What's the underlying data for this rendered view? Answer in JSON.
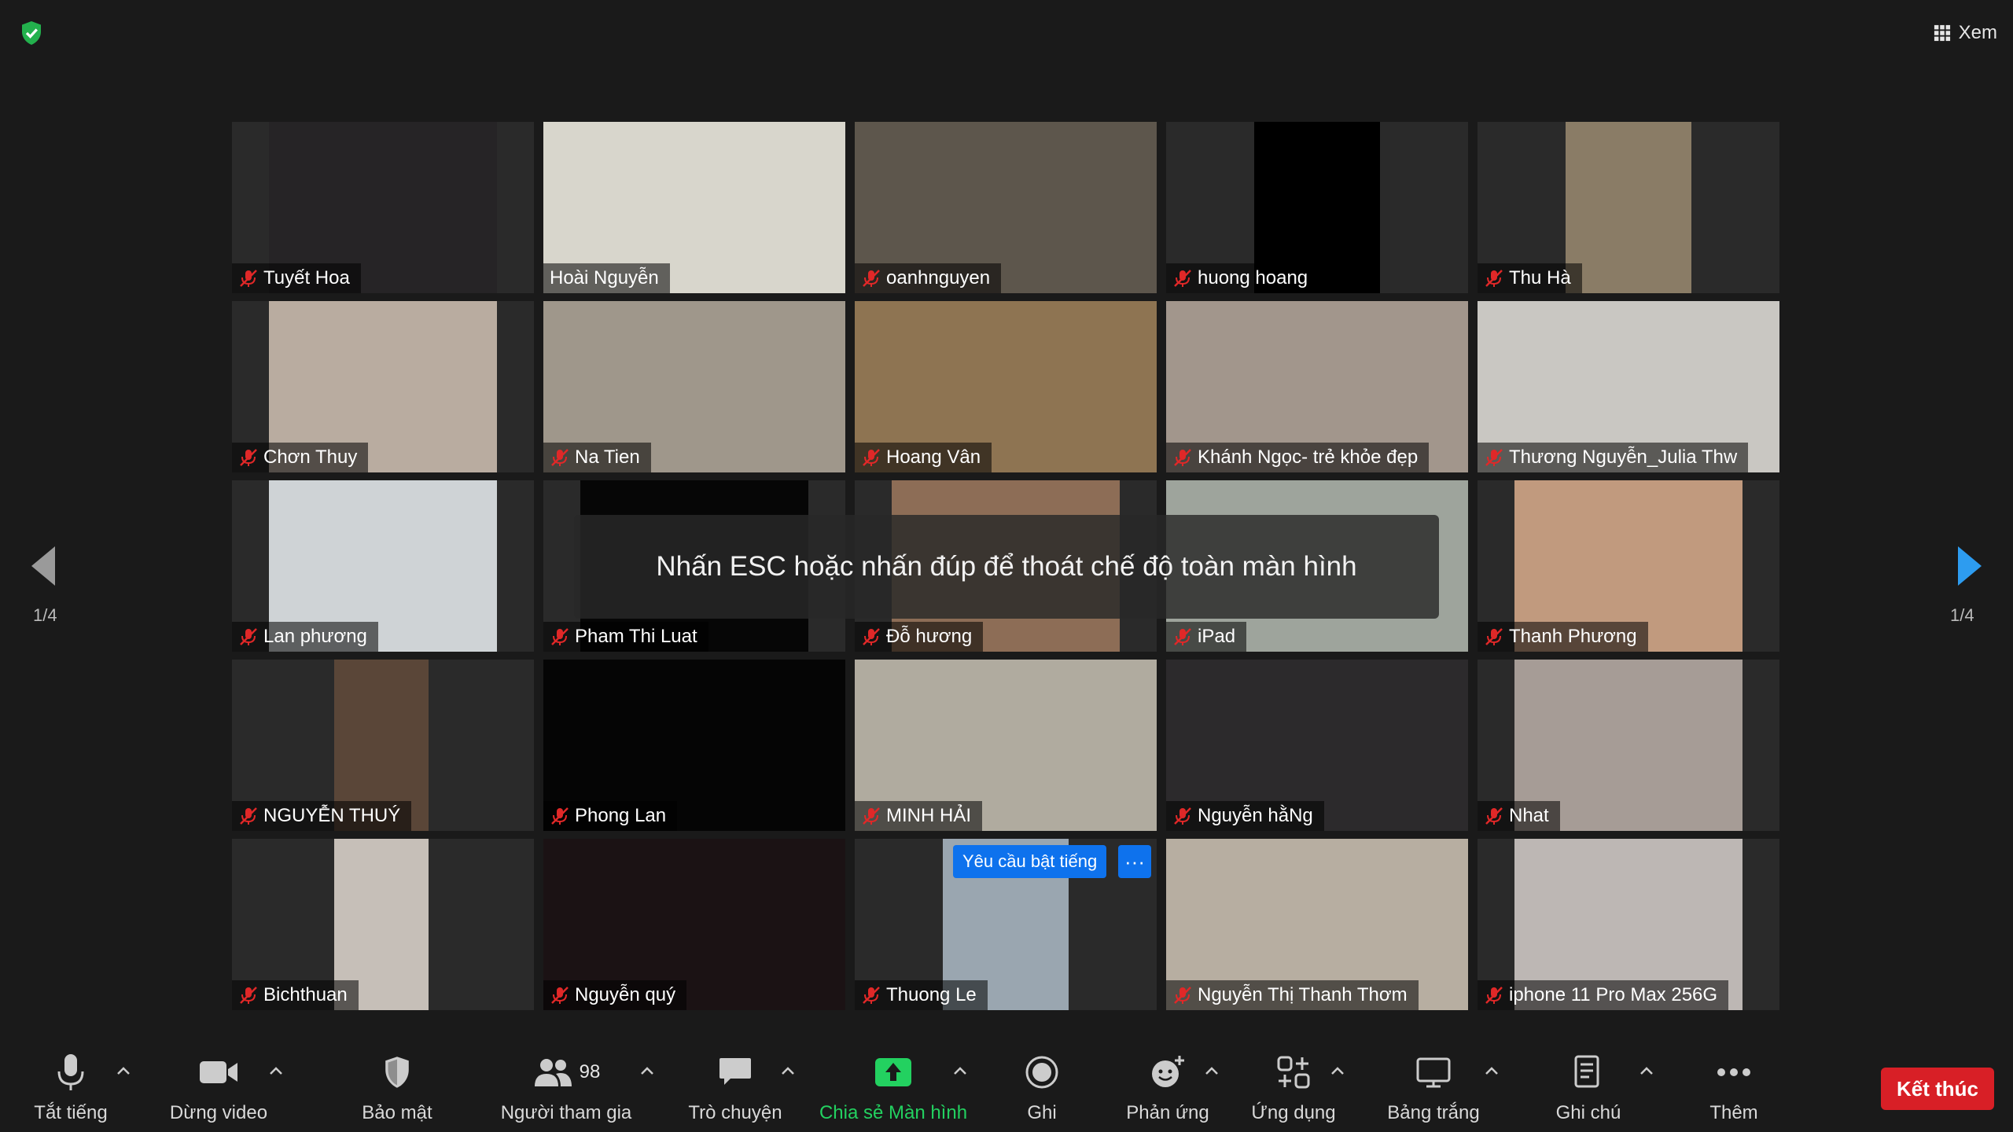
{
  "top": {
    "view_label": "Xem"
  },
  "banner": {
    "text": "Nhấn ESC hoặc nhấn đúp để thoát chế độ toàn màn hình"
  },
  "pagination": {
    "left": "1/4",
    "right": "1/4"
  },
  "tiles": [
    {
      "name": "Tuyết Hoa",
      "muted": true,
      "bg": "#262426",
      "active": false
    },
    {
      "name": "Hoài Nguyễn",
      "muted": false,
      "bg": "#d8d6cc",
      "active": true
    },
    {
      "name": "oanhnguyen",
      "muted": true,
      "bg": "#5d564c",
      "active": false
    },
    {
      "name": "huong hoang",
      "muted": true,
      "bg": "#000000",
      "active": false
    },
    {
      "name": "Thu Hà",
      "muted": true,
      "bg": "#8a7c66",
      "active": false
    },
    {
      "name": "Chơn Thuy",
      "muted": true,
      "bg": "#b9aca0",
      "active": false
    },
    {
      "name": "Na Tien",
      "muted": true,
      "bg": "#9f978b",
      "active": false
    },
    {
      "name": "Hoang Vân",
      "muted": true,
      "bg": "#8e7452",
      "active": false
    },
    {
      "name": "Khánh Ngọc- trẻ khỏe đẹp",
      "muted": true,
      "bg": "#a2968c",
      "active": false
    },
    {
      "name": "Thương Nguyễn_Julia Thw",
      "muted": true,
      "bg": "#c9c7c2",
      "active": false
    },
    {
      "name": "Lan phương",
      "muted": true,
      "bg": "#cfd3d6",
      "active": false
    },
    {
      "name": "Pham Thi Luat",
      "muted": true,
      "bg": "#060606",
      "active": false
    },
    {
      "name": "Đỗ hương",
      "muted": true,
      "bg": "#8d6d56",
      "active": false
    },
    {
      "name": "iPad",
      "muted": true,
      "bg": "#9ea49c",
      "active": false
    },
    {
      "name": "Thanh Phương",
      "muted": true,
      "bg": "#c19a7e",
      "active": false
    },
    {
      "name": "NGUYỄN THUÝ",
      "muted": true,
      "bg": "#5a4638",
      "active": false
    },
    {
      "name": "Phong Lan",
      "muted": true,
      "bg": "#050505",
      "active": false
    },
    {
      "name": "MINH HẢI",
      "muted": true,
      "bg": "#b0ab9f",
      "active": false
    },
    {
      "name": "Nguyễn hằNg",
      "muted": true,
      "bg": "#2c2a2c",
      "active": false
    },
    {
      "name": "Nhat",
      "muted": true,
      "bg": "#a69c96",
      "active": false
    },
    {
      "name": "Bichthuan",
      "muted": true,
      "bg": "#c6bfb8",
      "active": false
    },
    {
      "name": "Nguyễn quý",
      "muted": true,
      "bg": "#1b1214",
      "active": false
    },
    {
      "name": "Thuong Le",
      "muted": true,
      "bg": "#9aa6b0",
      "active": false
    },
    {
      "name": "Nguyễn Thị Thanh Thơm",
      "muted": true,
      "bg": "#b7aea1",
      "active": false
    },
    {
      "name": "iphone 11 Pro Max 256G",
      "muted": true,
      "bg": "#bdb7b4",
      "active": false
    }
  ],
  "unmute_request": {
    "label": "Yêu cầu bật tiếng",
    "more": "···"
  },
  "toolbar": {
    "mute": "Tắt tiếng",
    "video": "Dừng video",
    "security": "Bảo mật",
    "participants": "Người tham gia",
    "participants_count": "98",
    "chat": "Trò chuyện",
    "share": "Chia sẻ Màn hình",
    "record": "Ghi",
    "reactions": "Phản ứng",
    "apps": "Ứng dụng",
    "whiteboard": "Bảng trắng",
    "notes": "Ghi chú",
    "more": "Thêm",
    "end": "Kết thúc"
  },
  "colors": {
    "accent_green": "#23d160",
    "end_red": "#d81f26",
    "active_yellow": "#e8e64a",
    "blue": "#0e72ed"
  }
}
